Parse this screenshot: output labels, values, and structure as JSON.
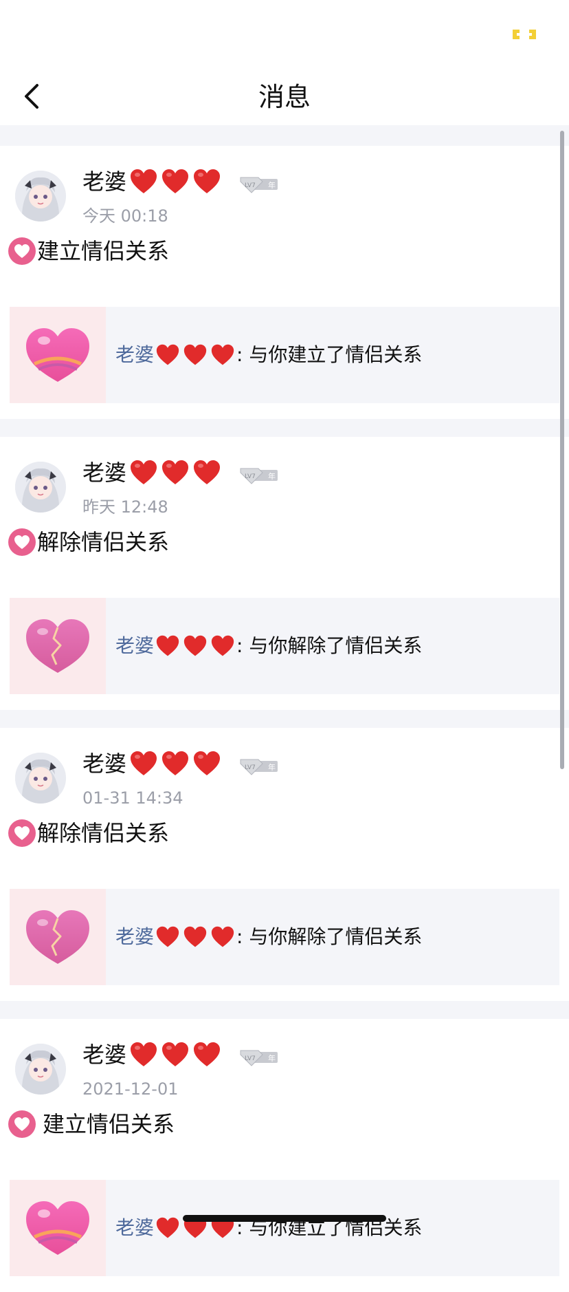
{
  "header": {
    "title": "消息",
    "back_icon": "chevron-left-icon"
  },
  "colors": {
    "accent_pink": "#e8608e",
    "name_link": "#4f6a9c",
    "timestamp": "#9b9ea8",
    "page_bg": "#f4f5f9",
    "status_indicator": "#f3cf36"
  },
  "level_badge": {
    "level": "LV7",
    "year": "年"
  },
  "messages": [
    {
      "user_name": "老婆",
      "hearts": "❤️❤️❤️",
      "time": "今天 00:18",
      "type": "建立情侣关系",
      "detail_name": "老婆",
      "detail_suffix": ": 与你建立了情侣关系",
      "thumb_icon": "full-heart-icon"
    },
    {
      "user_name": "老婆",
      "hearts": "❤️❤️❤️",
      "time": "昨天 12:48",
      "type": "解除情侣关系",
      "detail_name": "老婆",
      "detail_suffix": ": 与你解除了情侣关系",
      "thumb_icon": "broken-heart-icon"
    },
    {
      "user_name": "老婆",
      "hearts": "❤️❤️❤️",
      "time": "01-31 14:34",
      "type": "解除情侣关系",
      "detail_name": "老婆",
      "detail_suffix": ": 与你解除了情侣关系",
      "thumb_icon": "broken-heart-icon"
    },
    {
      "user_name": "老婆",
      "hearts": "❤️❤️❤️",
      "time": "2021-12-01",
      "type": "建立情侣关系",
      "detail_name": "老婆",
      "detail_suffix": ": 与你建立了情侣关系",
      "thumb_icon": "full-heart-icon"
    }
  ]
}
